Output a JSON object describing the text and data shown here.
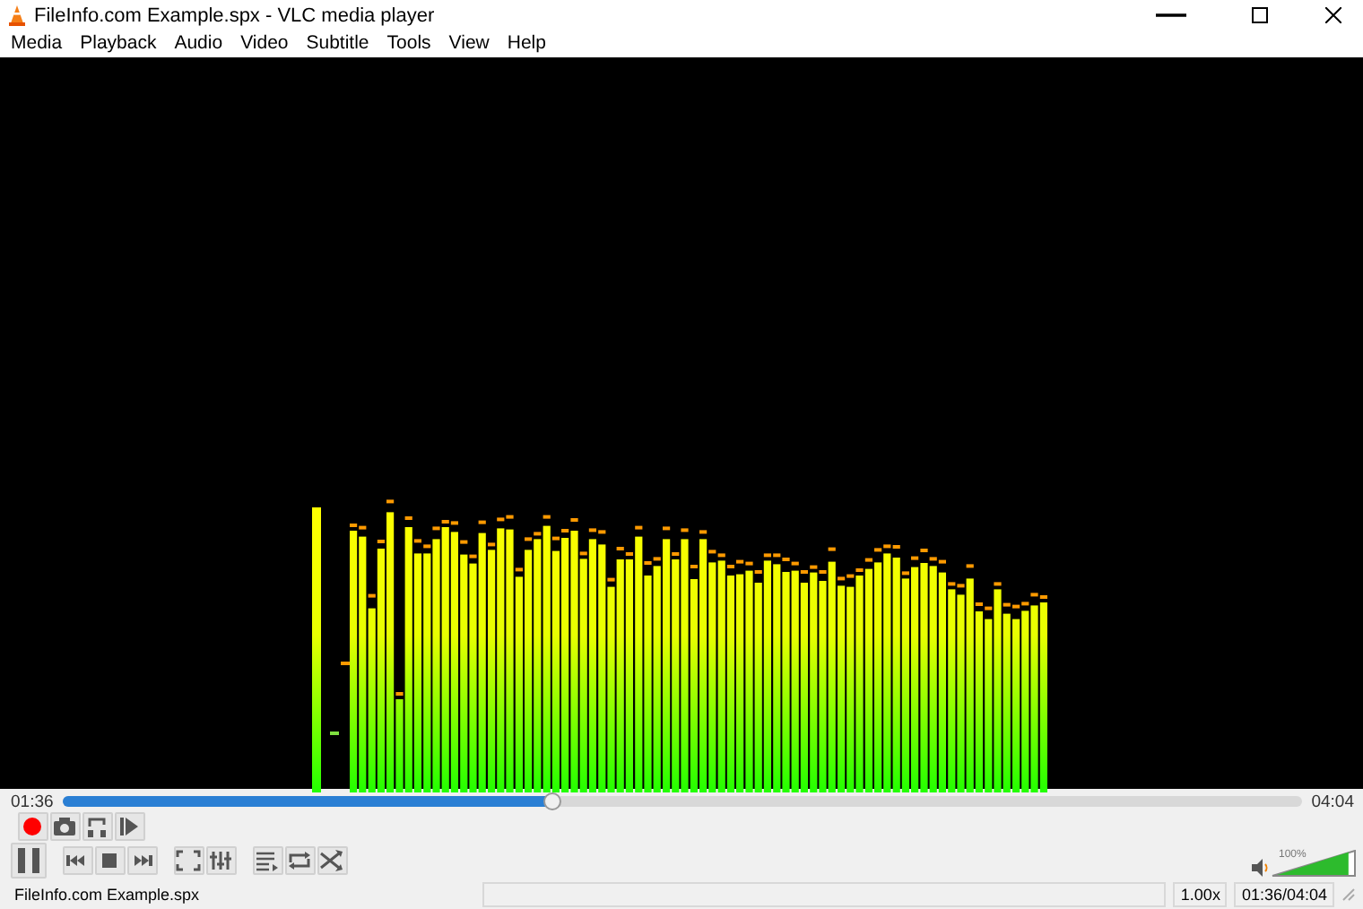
{
  "window": {
    "title": "FileInfo.com Example.spx - VLC media player"
  },
  "menu": [
    {
      "label": "Media"
    },
    {
      "label": "Playback"
    },
    {
      "label": "Audio"
    },
    {
      "label": "Video"
    },
    {
      "label": "Subtitle"
    },
    {
      "label": "Tools"
    },
    {
      "label": "View"
    },
    {
      "label": "Help"
    }
  ],
  "seek": {
    "elapsed": "01:36",
    "level": 0.395,
    "total": "04:04"
  },
  "controls": {
    "playing": true
  },
  "volume": {
    "reading": "100%",
    "level": 0.93
  },
  "status_bar": {
    "file": "FileInfo.com Example.spx",
    "speed": "1.00x",
    "time": "01:36/04:04"
  }
}
